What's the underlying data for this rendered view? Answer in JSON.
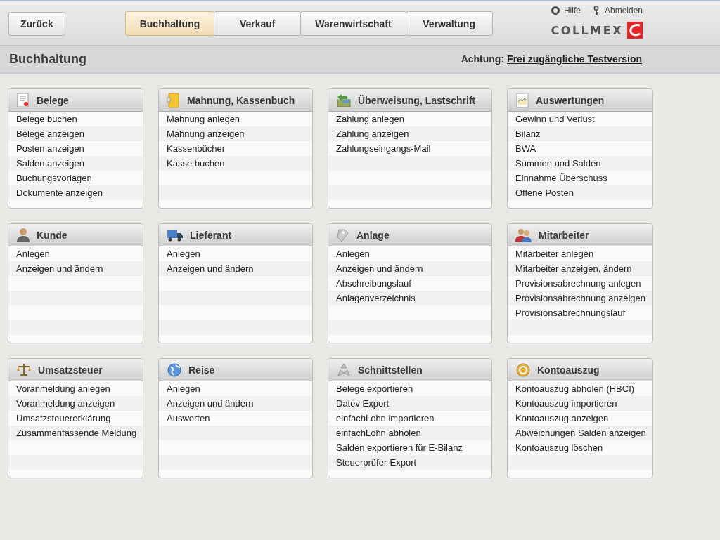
{
  "header": {
    "back_button": "Zurück",
    "tabs": [
      {
        "label": "Buchhaltung",
        "selected": true
      },
      {
        "label": "Verkauf",
        "selected": false
      },
      {
        "label": "Warenwirtschaft",
        "selected": false
      },
      {
        "label": "Verwaltung",
        "selected": false
      }
    ],
    "links": [
      "Hilfe",
      "Abmelden"
    ],
    "logo": "COLLMEX"
  },
  "title_bar": {
    "title": "Buchhaltung",
    "notice_label": "Achtung:",
    "notice_link": "Frei zugängliche Testversion"
  },
  "cards": [
    {
      "title": "Belege",
      "items": [
        "Belege buchen",
        "Belege anzeigen",
        "Posten anzeigen",
        "Salden anzeigen",
        "Buchungsvorlagen",
        "Dokumente anzeigen"
      ]
    },
    {
      "title": "Mahnung, Kassenbuch",
      "items": [
        "Mahnung anlegen",
        "Mahnung anzeigen",
        "Kassenbücher",
        "Kasse buchen"
      ]
    },
    {
      "title": "Überweisung, Lastschrift",
      "items": [
        "Zahlung anlegen",
        "Zahlung anzeigen",
        "Zahlungseingangs-Mail"
      ]
    },
    {
      "title": "Auswertungen",
      "items": [
        "Gewinn und Verlust",
        "Bilanz",
        "BWA",
        "Summen und Salden",
        "Einnahme Überschuss",
        "Offene Posten"
      ]
    },
    {
      "title": "Kunde",
      "items": [
        "Anlegen",
        "Anzeigen und ändern"
      ]
    },
    {
      "title": "Lieferant",
      "items": [
        "Anlegen",
        "Anzeigen und ändern"
      ]
    },
    {
      "title": "Anlage",
      "items": [
        "Anlegen",
        "Anzeigen und ändern",
        "Abschreibungslauf",
        "Anlagenverzeichnis"
      ]
    },
    {
      "title": "Mitarbeiter",
      "items": [
        "Mitarbeiter anlegen",
        "Mitarbeiter anzeigen, ändern",
        "Provisionsabrechnung anlegen",
        "Provisionsabrechnung anzeigen",
        "Provisionsabrechnungslauf"
      ]
    },
    {
      "title": "Umsatzsteuer",
      "items": [
        "Voranmeldung anlegen",
        "Voranmeldung anzeigen",
        "Umsatzsteuererklärung",
        "Zusammenfassende Meldung"
      ]
    },
    {
      "title": "Reise",
      "items": [
        "Anlegen",
        "Anzeigen und ändern",
        "Auswerten"
      ]
    },
    {
      "title": "Schnittstellen",
      "items": [
        "Belege exportieren",
        "Datev Export",
        "einfachLohn importieren",
        "einfachLohn abholen",
        "Salden exportieren für E-Bilanz",
        "Steuerprüfer-Export"
      ]
    },
    {
      "title": "Kontoauszug",
      "items": [
        "Kontoauszug abholen (HBCI)",
        "Kontoauszug importieren",
        "Kontoauszug anzeigen",
        "Abweichungen Salden anzeigen",
        "Kontoauszug löschen"
      ]
    }
  ]
}
